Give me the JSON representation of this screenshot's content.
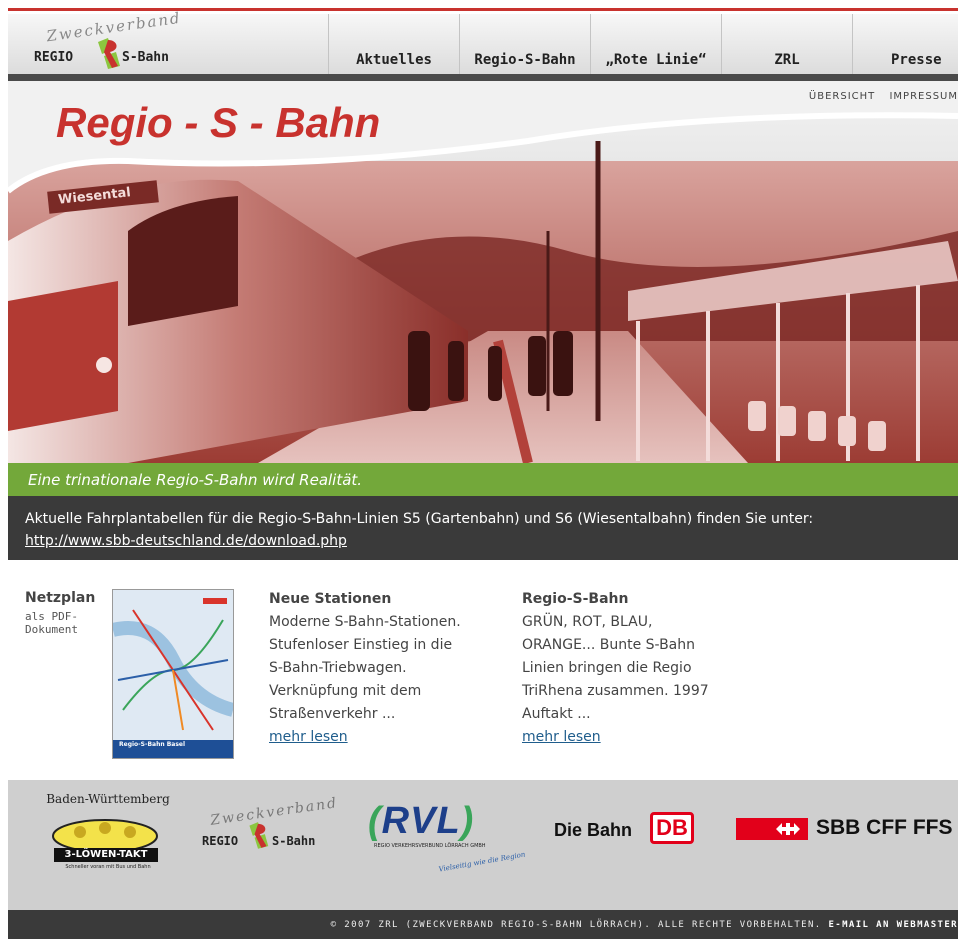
{
  "header": {
    "logo_top": "Zweckverband",
    "logo_left": "REGIO",
    "logo_right": "S-Bahn",
    "nav": [
      {
        "label": "Aktuelles"
      },
      {
        "label": "Regio-S-Bahn"
      },
      {
        "label": "„Rote Linie“"
      },
      {
        "label": "ZRL"
      },
      {
        "label": "Presse"
      }
    ]
  },
  "hero": {
    "title": "Regio - S - Bahn",
    "util_links": [
      "ÜBERSICHT",
      "IMPRESSUM"
    ],
    "sign_text": "Wiesental",
    "tagline": "Eine trinationale Regio-S-Bahn wird Realität."
  },
  "notice": {
    "text": "Aktuelle Fahrplantabellen für die Regio-S-Bahn-Linien S5 (Gartenbahn) und S6 (Wiesentalbahn) finden Sie unter:",
    "link": "http://www.sbb-deutschland.de/download.php"
  },
  "netzplan": {
    "title": "Netzplan",
    "subtitle": "als PDF-Dokument",
    "map_caption": "Regio-S-Bahn Basel"
  },
  "columns": [
    {
      "title": "Neue Stationen",
      "lines": [
        "Moderne S-Bahn-Stationen.",
        "Stufenloser Einstieg in die",
        "S-Bahn-Triebwagen.",
        "Verknüpfung mit dem",
        "Straßenverkehr ..."
      ],
      "more": "mehr lesen"
    },
    {
      "title": "Regio-S-Bahn",
      "lines": [
        "GRÜN, ROT, BLAU,",
        "ORANGE... Bunte S-Bahn",
        "Linien bringen die Regio",
        "TriRhena zusammen. 1997",
        "Auftakt ..."
      ],
      "more": "mehr lesen"
    }
  ],
  "partners": {
    "bw_title": "Baden-Württemberg",
    "bw_badge": "3-LÖWEN-TAKT",
    "bw_sub": "Schneller voran mit Bus und Bahn",
    "zrl_top": "Zweckverband",
    "zrl_left": "REGIO",
    "zrl_right": "S-Bahn",
    "rvl": "RVL",
    "rvl_sub": "REGIO VERKEHRSVERBUND LÖRRACH GMBH",
    "rvl_slogan": "Vielseitig wie die Region",
    "db_text": "Die Bahn",
    "db_logo": "DB",
    "sbb_text": "SBB CFF FFS"
  },
  "footer": {
    "text": "© 2007 ZRL (ZWECKVERBAND REGIO-S-BAHN LÖRRACH). ALLE RECHTE VORBEHALTEN.",
    "email": "E-MAIL AN WEBMASTER"
  },
  "colors": {
    "brand_red": "#c8322e",
    "green": "#73a83a",
    "dark": "#3a3a3a",
    "link": "#1f5d8c"
  }
}
